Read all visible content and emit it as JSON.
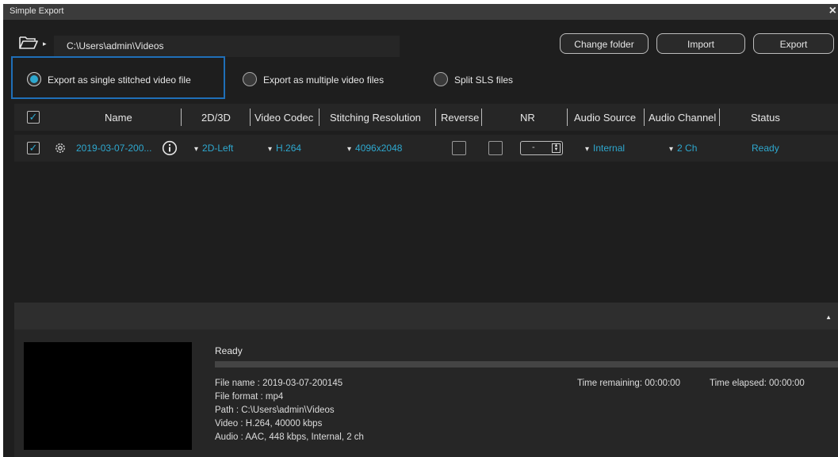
{
  "window": {
    "title": "Simple Export",
    "close_glyph": "×"
  },
  "toolbar": {
    "folder_icon": "folder-open-icon",
    "arrow_glyph": "▸",
    "path": "C:\\Users\\admin\\Videos",
    "buttons": {
      "change_folder": "Change folder",
      "import": "Import",
      "export": "Export"
    }
  },
  "export_mode": {
    "options": [
      {
        "label": "Export as single stitched video file",
        "selected": true
      },
      {
        "label": "Export as multiple video files",
        "selected": false
      },
      {
        "label": "Split SLS files",
        "selected": false
      }
    ]
  },
  "table": {
    "columns": [
      "Name",
      "2D/3D",
      "Video Codec",
      "Stitching Resolution",
      "Reverse",
      "NR",
      "Audio Source",
      "Audio Channel",
      "Status"
    ],
    "header_checked": "✓",
    "rows": [
      {
        "checked": "✓",
        "name": "2019-03-07-200...",
        "mode": "2D-Left",
        "codec": "H.264",
        "resolution": "4096x2048",
        "reverse": false,
        "nr_value": "-",
        "audio_source": "Internal",
        "audio_channel": "2 Ch",
        "status": "Ready"
      }
    ]
  },
  "details": {
    "status": "Ready",
    "progress": 0,
    "file_name": "File name : 2019-03-07-200145",
    "file_format": "File format : mp4",
    "path": "Path : C:\\Users\\admin\\Videos",
    "video": "Video : H.264, 40000 kbps",
    "audio": "Audio : AAC, 448 kbps, Internal, 2 ch",
    "time_remaining": "Time remaining: 00:00:00",
    "time_elapsed": "Time elapsed: 00:00:00"
  },
  "colors": {
    "accent": "#2ea8cf",
    "background": "#1e1e1e",
    "highlight_border": "#1f6fb8"
  }
}
